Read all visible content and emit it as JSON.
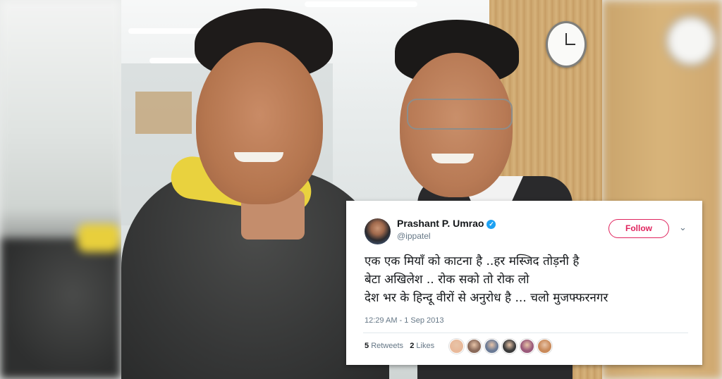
{
  "tweet": {
    "author_name": "Prashant P. Umrao",
    "author_handle": "@ippatel",
    "follow_label": "Follow",
    "lines": [
      "एक एक मियाँ को काटना है ..हर मस्जिद तोड़नी है",
      "बेटा अखिलेश .. रोक सको तो रोक लो",
      "देश भर के हिन्दू वीरों से अनुरोध है ... चलो मुजफ्फरनगर"
    ],
    "timestamp": "12:29 AM - 1 Sep 2013",
    "retweets_count": "5",
    "retweets_label": "Retweets",
    "likes_count": "2",
    "likes_label": "Likes",
    "liker_colors": [
      "#e8b99a",
      "#8a6a5a",
      "#6a7a95",
      "#3b3b3b",
      "#9a5a7a",
      "#c98a5a"
    ]
  },
  "colors": {
    "follow_accent": "#e0245e",
    "verified_badge": "#1da1f2",
    "secondary_text": "#657786"
  },
  "icons": {
    "verified": "verified-badge-icon",
    "menu": "chevron-down-icon"
  }
}
